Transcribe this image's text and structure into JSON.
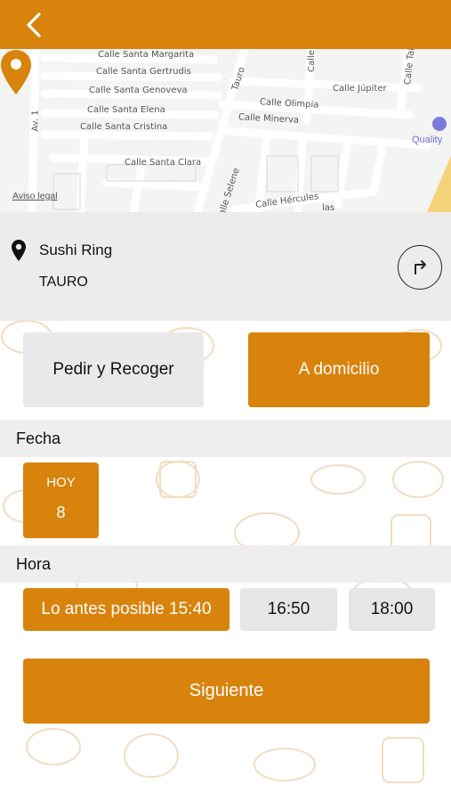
{
  "colors": {
    "accent": "#d8830c",
    "panel": "#ececec",
    "chip_inactive": "#e6e6e6"
  },
  "header": {
    "back_icon": "chevron-left-icon"
  },
  "map": {
    "streets": {
      "margarita": "Calle Santa Margarita",
      "gertrudis": "Calle Santa Gertrudis",
      "genoveva": "Calle Santa Genoveva",
      "elena": "Calle Santa Elena",
      "cristina": "Calle Santa Cristina",
      "clara": "Calle Santa Clara",
      "tauro": "Tauro",
      "olimpia": "Calle Olimpia",
      "minerva": "Calle Minerva",
      "jupiter": "Calle Júpiter",
      "selene": "Calle Selene",
      "hercules": "Calle Hércules",
      "vegas": "las",
      "av1": "Av. 1",
      "calle_top": "Calle",
      "calle_tal": "Calle Tal"
    },
    "poi_label": "Quality",
    "legal_link": "Aviso legal"
  },
  "restaurant": {
    "name": "Sushi Ring",
    "zone": "TAURO",
    "location_icon": "map-pin-icon",
    "directions_icon": "directions-arrow-icon"
  },
  "order_type": {
    "pickup_label": "Pedir y Recoger",
    "delivery_label": "A domicilio",
    "selected": "delivery"
  },
  "date": {
    "section_label": "Fecha",
    "day_label": "HOY",
    "day_number": "8"
  },
  "time": {
    "section_label": "Hora",
    "slots": [
      "Lo antes posible 15:40",
      "16:50",
      "18:00"
    ],
    "selected": 0
  },
  "next_label": "Siguiente"
}
